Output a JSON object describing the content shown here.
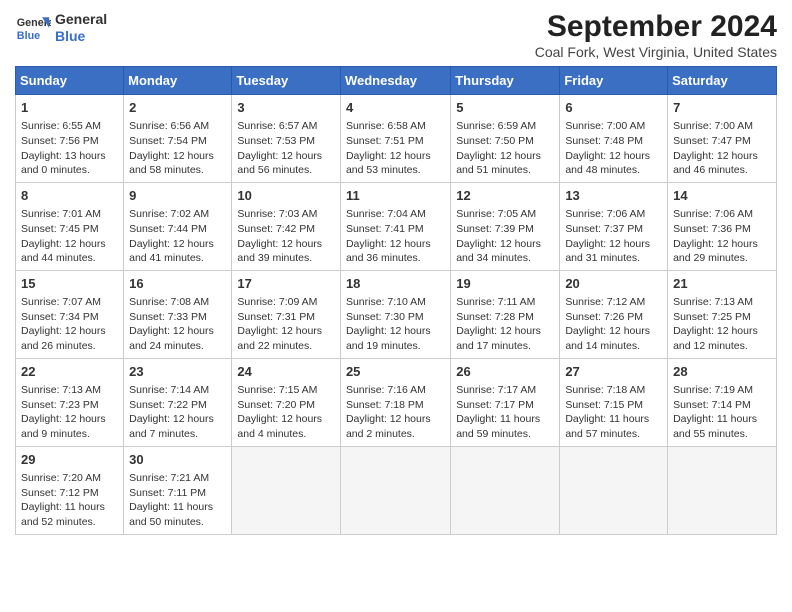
{
  "header": {
    "logo_line1": "General",
    "logo_line2": "Blue",
    "title": "September 2024",
    "subtitle": "Coal Fork, West Virginia, United States"
  },
  "days_of_week": [
    "Sunday",
    "Monday",
    "Tuesday",
    "Wednesday",
    "Thursday",
    "Friday",
    "Saturday"
  ],
  "weeks": [
    [
      {
        "day": "1",
        "lines": [
          "Sunrise: 6:55 AM",
          "Sunset: 7:56 PM",
          "Daylight: 13 hours",
          "and 0 minutes."
        ]
      },
      {
        "day": "2",
        "lines": [
          "Sunrise: 6:56 AM",
          "Sunset: 7:54 PM",
          "Daylight: 12 hours",
          "and 58 minutes."
        ]
      },
      {
        "day": "3",
        "lines": [
          "Sunrise: 6:57 AM",
          "Sunset: 7:53 PM",
          "Daylight: 12 hours",
          "and 56 minutes."
        ]
      },
      {
        "day": "4",
        "lines": [
          "Sunrise: 6:58 AM",
          "Sunset: 7:51 PM",
          "Daylight: 12 hours",
          "and 53 minutes."
        ]
      },
      {
        "day": "5",
        "lines": [
          "Sunrise: 6:59 AM",
          "Sunset: 7:50 PM",
          "Daylight: 12 hours",
          "and 51 minutes."
        ]
      },
      {
        "day": "6",
        "lines": [
          "Sunrise: 7:00 AM",
          "Sunset: 7:48 PM",
          "Daylight: 12 hours",
          "and 48 minutes."
        ]
      },
      {
        "day": "7",
        "lines": [
          "Sunrise: 7:00 AM",
          "Sunset: 7:47 PM",
          "Daylight: 12 hours",
          "and 46 minutes."
        ]
      }
    ],
    [
      {
        "day": "8",
        "lines": [
          "Sunrise: 7:01 AM",
          "Sunset: 7:45 PM",
          "Daylight: 12 hours",
          "and 44 minutes."
        ]
      },
      {
        "day": "9",
        "lines": [
          "Sunrise: 7:02 AM",
          "Sunset: 7:44 PM",
          "Daylight: 12 hours",
          "and 41 minutes."
        ]
      },
      {
        "day": "10",
        "lines": [
          "Sunrise: 7:03 AM",
          "Sunset: 7:42 PM",
          "Daylight: 12 hours",
          "and 39 minutes."
        ]
      },
      {
        "day": "11",
        "lines": [
          "Sunrise: 7:04 AM",
          "Sunset: 7:41 PM",
          "Daylight: 12 hours",
          "and 36 minutes."
        ]
      },
      {
        "day": "12",
        "lines": [
          "Sunrise: 7:05 AM",
          "Sunset: 7:39 PM",
          "Daylight: 12 hours",
          "and 34 minutes."
        ]
      },
      {
        "day": "13",
        "lines": [
          "Sunrise: 7:06 AM",
          "Sunset: 7:37 PM",
          "Daylight: 12 hours",
          "and 31 minutes."
        ]
      },
      {
        "day": "14",
        "lines": [
          "Sunrise: 7:06 AM",
          "Sunset: 7:36 PM",
          "Daylight: 12 hours",
          "and 29 minutes."
        ]
      }
    ],
    [
      {
        "day": "15",
        "lines": [
          "Sunrise: 7:07 AM",
          "Sunset: 7:34 PM",
          "Daylight: 12 hours",
          "and 26 minutes."
        ]
      },
      {
        "day": "16",
        "lines": [
          "Sunrise: 7:08 AM",
          "Sunset: 7:33 PM",
          "Daylight: 12 hours",
          "and 24 minutes."
        ]
      },
      {
        "day": "17",
        "lines": [
          "Sunrise: 7:09 AM",
          "Sunset: 7:31 PM",
          "Daylight: 12 hours",
          "and 22 minutes."
        ]
      },
      {
        "day": "18",
        "lines": [
          "Sunrise: 7:10 AM",
          "Sunset: 7:30 PM",
          "Daylight: 12 hours",
          "and 19 minutes."
        ]
      },
      {
        "day": "19",
        "lines": [
          "Sunrise: 7:11 AM",
          "Sunset: 7:28 PM",
          "Daylight: 12 hours",
          "and 17 minutes."
        ]
      },
      {
        "day": "20",
        "lines": [
          "Sunrise: 7:12 AM",
          "Sunset: 7:26 PM",
          "Daylight: 12 hours",
          "and 14 minutes."
        ]
      },
      {
        "day": "21",
        "lines": [
          "Sunrise: 7:13 AM",
          "Sunset: 7:25 PM",
          "Daylight: 12 hours",
          "and 12 minutes."
        ]
      }
    ],
    [
      {
        "day": "22",
        "lines": [
          "Sunrise: 7:13 AM",
          "Sunset: 7:23 PM",
          "Daylight: 12 hours",
          "and 9 minutes."
        ]
      },
      {
        "day": "23",
        "lines": [
          "Sunrise: 7:14 AM",
          "Sunset: 7:22 PM",
          "Daylight: 12 hours",
          "and 7 minutes."
        ]
      },
      {
        "day": "24",
        "lines": [
          "Sunrise: 7:15 AM",
          "Sunset: 7:20 PM",
          "Daylight: 12 hours",
          "and 4 minutes."
        ]
      },
      {
        "day": "25",
        "lines": [
          "Sunrise: 7:16 AM",
          "Sunset: 7:18 PM",
          "Daylight: 12 hours",
          "and 2 minutes."
        ]
      },
      {
        "day": "26",
        "lines": [
          "Sunrise: 7:17 AM",
          "Sunset: 7:17 PM",
          "Daylight: 11 hours",
          "and 59 minutes."
        ]
      },
      {
        "day": "27",
        "lines": [
          "Sunrise: 7:18 AM",
          "Sunset: 7:15 PM",
          "Daylight: 11 hours",
          "and 57 minutes."
        ]
      },
      {
        "day": "28",
        "lines": [
          "Sunrise: 7:19 AM",
          "Sunset: 7:14 PM",
          "Daylight: 11 hours",
          "and 55 minutes."
        ]
      }
    ],
    [
      {
        "day": "29",
        "lines": [
          "Sunrise: 7:20 AM",
          "Sunset: 7:12 PM",
          "Daylight: 11 hours",
          "and 52 minutes."
        ]
      },
      {
        "day": "30",
        "lines": [
          "Sunrise: 7:21 AM",
          "Sunset: 7:11 PM",
          "Daylight: 11 hours",
          "and 50 minutes."
        ]
      },
      {
        "day": "",
        "lines": []
      },
      {
        "day": "",
        "lines": []
      },
      {
        "day": "",
        "lines": []
      },
      {
        "day": "",
        "lines": []
      },
      {
        "day": "",
        "lines": []
      }
    ]
  ],
  "colors": {
    "header_bg": "#3a6fc4",
    "header_text": "#ffffff",
    "cell_border": "#cccccc",
    "empty_bg": "#f5f5f5"
  }
}
